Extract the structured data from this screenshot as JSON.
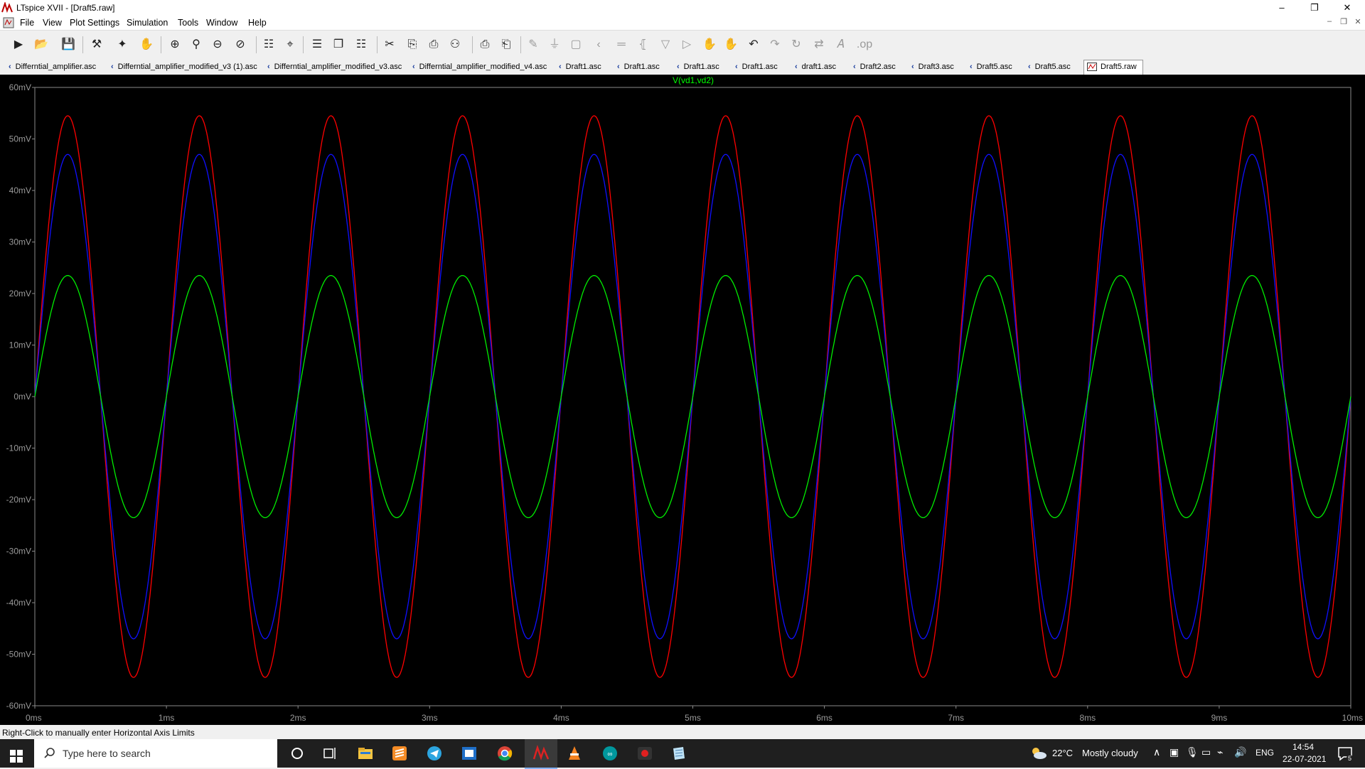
{
  "window": {
    "title": "LTspice XVII - [Draft5.raw]"
  },
  "menu": [
    "File",
    "View",
    "Plot Settings",
    "Simulation",
    "Tools",
    "Window",
    "Help"
  ],
  "toolbar_icons": [
    "run-icon",
    "open-icon",
    "save-icon",
    "control-panel-icon",
    "halt-icon",
    "pan-icon",
    "zoom-in-icon",
    "zoom-area-icon",
    "zoom-out-icon",
    "zoom-fit-icon",
    "autorange-icon",
    "cursor-icon",
    "tile-horizontal-icon",
    "cascade-icon",
    "tile-vertical-icon",
    "cut-icon",
    "copy-icon",
    "paste-icon",
    "find-icon",
    "print-icon",
    "print-preview-icon",
    "wire-icon",
    "ground-icon",
    "label-icon",
    "resistor-icon",
    "capacitor-icon",
    "inductor-icon",
    "diode-icon",
    "component-icon",
    "move-icon",
    "drag-icon",
    "undo-icon",
    "redo-icon",
    "rotate-icon",
    "mirror-icon",
    "text-icon",
    "spice-directive-icon"
  ],
  "tabs": [
    {
      "label": "Differntial_amplifier.asc",
      "active": false
    },
    {
      "label": "Differntial_amplifier_modified_v3 (1).asc",
      "active": false
    },
    {
      "label": "Differntial_amplifier_modified_v3.asc",
      "active": false
    },
    {
      "label": "Differntial_amplifier_modified_v4.asc",
      "active": false
    },
    {
      "label": "Draft1.asc",
      "active": false
    },
    {
      "label": "Draft1.asc",
      "active": false
    },
    {
      "label": "Draft1.asc",
      "active": false
    },
    {
      "label": "Draft1.asc",
      "active": false
    },
    {
      "label": "draft1.asc",
      "active": false
    },
    {
      "label": "Draft2.asc",
      "active": false
    },
    {
      "label": "Draft3.asc",
      "active": false
    },
    {
      "label": "Draft5.asc",
      "active": false
    },
    {
      "label": "Draft5.asc",
      "active": false
    },
    {
      "label": "Draft5.raw",
      "active": true
    }
  ],
  "chart_data": {
    "type": "line",
    "title": "",
    "trace_label": "V(vd1,vd2)",
    "xlim": [
      0,
      10
    ],
    "ylim": [
      -60,
      60
    ],
    "x_ticks": [
      "0ms",
      "1ms",
      "2ms",
      "3ms",
      "4ms",
      "5ms",
      "6ms",
      "7ms",
      "8ms",
      "9ms",
      "10ms"
    ],
    "y_ticks": [
      "60mV",
      "50mV",
      "40mV",
      "30mV",
      "20mV",
      "10mV",
      "0mV",
      "-10mV",
      "-20mV",
      "-30mV",
      "-40mV",
      "-50mV",
      "-60mV"
    ],
    "grid": false,
    "frequency_khz": 1,
    "series": [
      {
        "color": "#ff0000",
        "amplitude_mV": 54.5,
        "phase": "sine"
      },
      {
        "color": "#1010ff",
        "amplitude_mV": 47,
        "phase": "sine"
      },
      {
        "color": "#00ee00",
        "amplitude_mV": 23.5,
        "phase": "sine"
      }
    ]
  },
  "status": {
    "text": "Right-Click to manually enter Horizontal Axis Limits"
  },
  "taskbar": {
    "search_placeholder": "Type here to search",
    "weather_temp": "22°C",
    "weather_text": "Mostly cloudy",
    "language": "ENG",
    "time": "14:54",
    "date": "22-07-2021",
    "notification_count": "5"
  }
}
